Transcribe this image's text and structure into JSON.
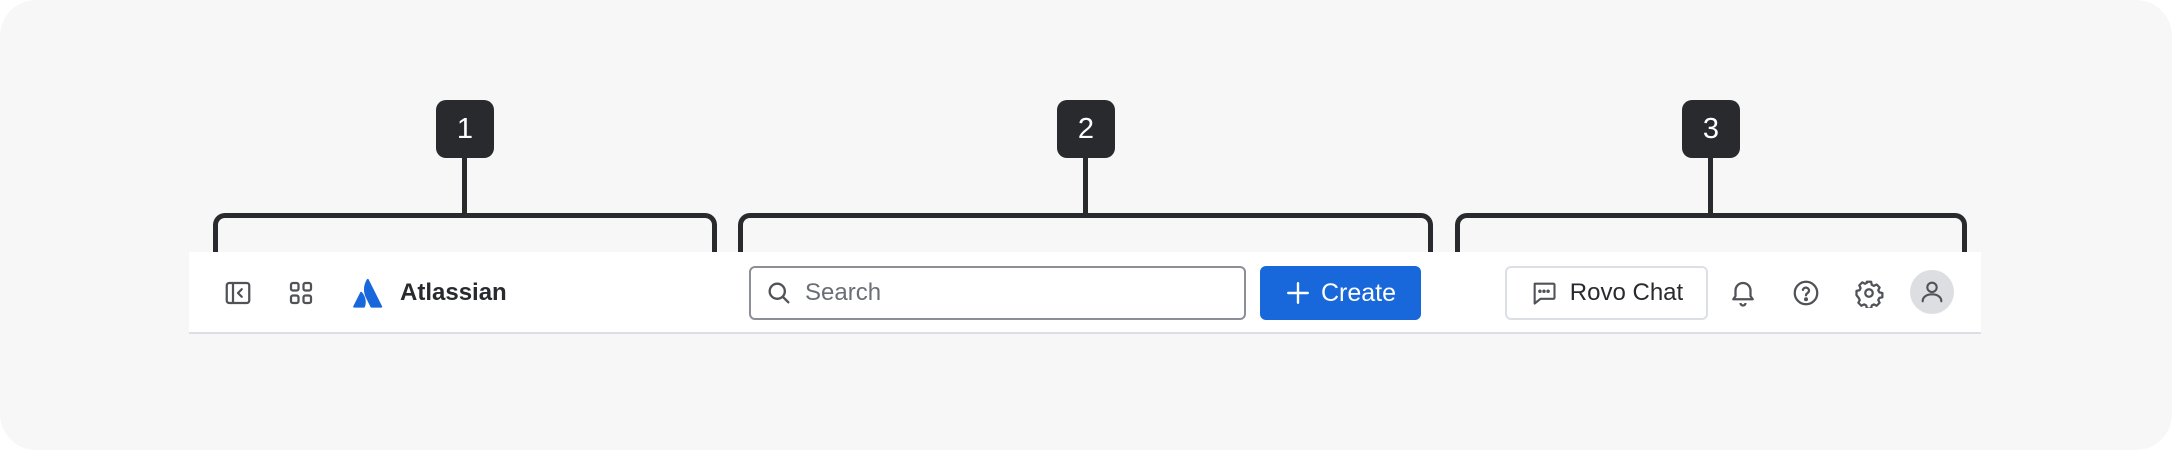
{
  "callouts": [
    "1",
    "2",
    "3"
  ],
  "navbar": {
    "sidebar_toggle_icon": "sidebar-collapse-icon",
    "app_switcher_icon": "app-grid-icon",
    "logo": {
      "icon": "atlassian-logo-icon",
      "name": "Atlassian"
    },
    "search": {
      "placeholder": "Search",
      "icon": "search-icon"
    },
    "create_button": {
      "label": "Create",
      "icon": "plus-icon"
    },
    "rovo_chat_button": {
      "label": "Rovo Chat",
      "icon": "chat-icon"
    },
    "notifications_icon": "bell-icon",
    "help_icon": "help-icon",
    "settings_icon": "gear-icon",
    "avatar_icon": "user-icon"
  },
  "colors": {
    "canvas_bg": "#f7f7f7",
    "navbar_bg": "#ffffff",
    "callout_bg": "#292a2e",
    "brand_blue": "#1868db",
    "text_primary": "#292a2e",
    "text_subtle": "#6b6e76",
    "border": "#dcdfe4",
    "search_border": "#8c8f97",
    "avatar_bg": "#dddee1"
  }
}
